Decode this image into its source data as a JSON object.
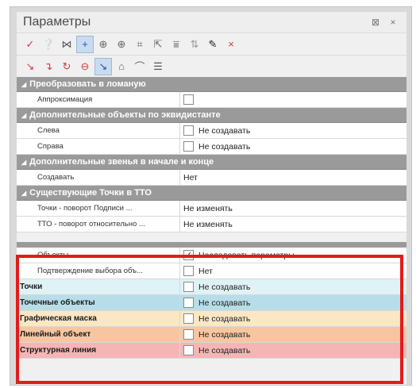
{
  "window": {
    "title": "Параметры",
    "pin_glyph": "⊠",
    "close_glyph": "×"
  },
  "toolbar1": [
    {
      "icon": "checkmark-icon",
      "glyph": "✓",
      "color": "#d23b3b"
    },
    {
      "icon": "help-cursor-icon",
      "glyph": "❔",
      "color": "#1f4fbf"
    },
    {
      "icon": "split-icon",
      "glyph": "⋈",
      "color": "#555555"
    },
    {
      "icon": "crosshair-icon",
      "glyph": "+",
      "color": "#1f4fbf",
      "active": true
    },
    {
      "icon": "target-icon",
      "glyph": "⊕",
      "color": "#666666"
    },
    {
      "icon": "point-add-icon",
      "glyph": "⊕",
      "color": "#666666"
    },
    {
      "icon": "point-shape-icon",
      "glyph": "⌗",
      "color": "#666666"
    },
    {
      "icon": "cursor-icon",
      "glyph": "⇱",
      "color": "#666666"
    },
    {
      "icon": "align-icon",
      "glyph": "⩸",
      "color": "#666666"
    },
    {
      "icon": "arrows-icon",
      "glyph": "⇅",
      "color": "#999999"
    },
    {
      "icon": "eyedropper-icon",
      "glyph": "✎",
      "color": "#1a1a1a"
    },
    {
      "icon": "delete-icon",
      "glyph": "×",
      "color": "#d23b3b"
    }
  ],
  "toolbar2": [
    {
      "icon": "line-left-icon",
      "glyph": "↘",
      "color": "#d23b3b"
    },
    {
      "icon": "line-right-icon",
      "glyph": "↴",
      "color": "#d23b3b"
    },
    {
      "icon": "circle-arrow-icon",
      "glyph": "↻",
      "color": "#d23b3b"
    },
    {
      "icon": "circle-plus-icon",
      "glyph": "⊖",
      "color": "#d23b3b"
    },
    {
      "icon": "curve-icon",
      "glyph": "↘",
      "color": "#1f4fbf",
      "active": true
    },
    {
      "icon": "shape-icon",
      "glyph": "⌂",
      "color": "#666666"
    },
    {
      "icon": "dome-icon",
      "glyph": "⌒",
      "color": "#666666"
    },
    {
      "icon": "list-icon",
      "glyph": "☰",
      "color": "#555555"
    }
  ],
  "sections": [
    {
      "title": "Преобразовать в ломаную",
      "rows": [
        {
          "name": "Аппроксимация",
          "checkbox": true,
          "checked": false,
          "value": ""
        }
      ]
    },
    {
      "title": "Дополнительные объекты по эквидистанте",
      "rows": [
        {
          "name": "Слева",
          "checkbox": true,
          "checked": false,
          "value": "Не создавать"
        },
        {
          "name": "Справа",
          "checkbox": true,
          "checked": false,
          "value": "Не создавать"
        }
      ]
    },
    {
      "title": "Дополнительные звенья в начале и конце",
      "rows": [
        {
          "name": "Создавать",
          "checkbox": false,
          "checked": false,
          "value": "Нет"
        }
      ]
    },
    {
      "title": "Существующие Точки в ТТО",
      "rows": [
        {
          "name": "Точки - поворот Подписи ...",
          "checkbox": false,
          "checked": false,
          "value": "Не изменять"
        },
        {
          "name": "ТТО - поворот относительно ...",
          "checkbox": false,
          "checked": false,
          "value": "Не изменять"
        }
      ]
    }
  ],
  "highlighted_rows": [
    {
      "name": "Объекты",
      "checkbox": true,
      "checked": true,
      "value": "Наследовать параметры",
      "bg": "#ffffff",
      "bold": false
    },
    {
      "name": "Подтверждение выбора объ...",
      "checkbox": true,
      "checked": false,
      "value": "Нет",
      "bg": "#ffffff",
      "bold": false
    },
    {
      "name": "Точки",
      "checkbox": true,
      "checked": false,
      "value": "Не создавать",
      "bg": "#dff2f5",
      "bold": true
    },
    {
      "name": "Точечные объекты",
      "checkbox": true,
      "checked": false,
      "value": "Не создавать",
      "bg": "#b7dde8",
      "bold": true
    },
    {
      "name": "Графическая маска",
      "checkbox": true,
      "checked": false,
      "value": "Не создавать",
      "bg": "#fbe7c4",
      "bold": true
    },
    {
      "name": "Линейный объект",
      "checkbox": true,
      "checked": false,
      "value": "Не создавать",
      "bg": "#f7c6a0",
      "bold": true
    },
    {
      "name": "Структурная линия",
      "checkbox": true,
      "checked": false,
      "value": "Не создавать",
      "bg": "#f6b5b5",
      "bold": true
    }
  ],
  "highlight_color": "#e31b1b"
}
